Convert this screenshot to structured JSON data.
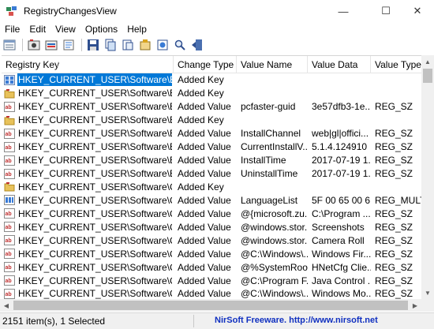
{
  "window": {
    "title": "RegistryChangesView",
    "minimize_glyph": "—",
    "maximize_glyph": "☐",
    "close_glyph": "✕"
  },
  "menu": [
    "File",
    "Edit",
    "View",
    "Options",
    "Help"
  ],
  "toolbar_icons": [
    "columns-icon",
    "save-snapshot-icon",
    "open-snapshot-icon",
    "refresh-icon",
    "save-icon",
    "copy-icon",
    "export-icon",
    "properties-icon",
    "html-report-icon",
    "find-icon",
    "exit-icon"
  ],
  "columns": [
    "Registry Key",
    "Change Type",
    "Value Name",
    "Value Data",
    "Value Type"
  ],
  "sort_indicator": "/",
  "rows": [
    {
      "icon": "reg-key",
      "key": "HKEY_CURRENT_USER\\Software\\Baidu S...",
      "change": "Added Key",
      "name": "",
      "data": "",
      "vtype": "",
      "selected": true
    },
    {
      "icon": "folder",
      "key": "HKEY_CURRENT_USER\\Software\\Baidu S...",
      "change": "Added Key",
      "name": "",
      "data": "",
      "vtype": ""
    },
    {
      "icon": "reg-value",
      "key": "HKEY_CURRENT_USER\\Software\\Baidu S...",
      "change": "Added Value",
      "name": "pcfaster-guid",
      "data": "3e57dfb3-1e...",
      "vtype": "REG_SZ"
    },
    {
      "icon": "folder",
      "key": "HKEY_CURRENT_USER\\Software\\Baidu ...",
      "change": "Added Key",
      "name": "",
      "data": "",
      "vtype": ""
    },
    {
      "icon": "reg-value",
      "key": "HKEY_CURRENT_USER\\Software\\Baidu ...",
      "change": "Added Value",
      "name": "InstallChannel",
      "data": "web|gl|offici...",
      "vtype": "REG_SZ"
    },
    {
      "icon": "reg-value",
      "key": "HKEY_CURRENT_USER\\Software\\Baidu ...",
      "change": "Added Value",
      "name": "CurrentInstallV...",
      "data": "5.1.4.124910",
      "vtype": "REG_SZ"
    },
    {
      "icon": "reg-value",
      "key": "HKEY_CURRENT_USER\\Software\\Baidu ...",
      "change": "Added Value",
      "name": "InstallTime",
      "data": "2017-07-19 1...",
      "vtype": "REG_SZ"
    },
    {
      "icon": "reg-value",
      "key": "HKEY_CURRENT_USER\\Software\\Baidu ...",
      "change": "Added Value",
      "name": "UninstallTime",
      "data": "2017-07-19 1...",
      "vtype": "REG_SZ"
    },
    {
      "icon": "folder",
      "key": "HKEY_CURRENT_USER\\Software\\Classes\\...",
      "change": "Added Key",
      "name": "",
      "data": "",
      "vtype": ""
    },
    {
      "icon": "reg-binary",
      "key": "HKEY_CURRENT_USER\\Software\\Classes\\...",
      "change": "Added Value",
      "name": "LanguageList",
      "data": "5F 00 65 00 6...",
      "vtype": "REG_MULTI_..."
    },
    {
      "icon": "reg-value",
      "key": "HKEY_CURRENT_USER\\Software\\Classes\\...",
      "change": "Added Value",
      "name": "@{microsoft.zu...",
      "data": "C:\\Program ...",
      "vtype": "REG_SZ"
    },
    {
      "icon": "reg-value",
      "key": "HKEY_CURRENT_USER\\Software\\Classes\\...",
      "change": "Added Value",
      "name": "@windows.stor...",
      "data": "Screenshots",
      "vtype": "REG_SZ"
    },
    {
      "icon": "reg-value",
      "key": "HKEY_CURRENT_USER\\Software\\Classes\\...",
      "change": "Added Value",
      "name": "@windows.stor...",
      "data": "Camera Roll",
      "vtype": "REG_SZ"
    },
    {
      "icon": "reg-value",
      "key": "HKEY_CURRENT_USER\\Software\\Classes\\...",
      "change": "Added Value",
      "name": "@C:\\Windows\\...",
      "data": "Windows Fir...",
      "vtype": "REG_SZ"
    },
    {
      "icon": "reg-value",
      "key": "HKEY_CURRENT_USER\\Software\\Classes\\...",
      "change": "Added Value",
      "name": "@%SystemRoo...",
      "data": "HNetCfg Clie...",
      "vtype": "REG_SZ"
    },
    {
      "icon": "reg-value",
      "key": "HKEY_CURRENT_USER\\Software\\Classes\\...",
      "change": "Added Value",
      "name": "@C:\\Program F...",
      "data": "Java Control ...",
      "vtype": "REG_SZ"
    },
    {
      "icon": "reg-value",
      "key": "HKEY_CURRENT_USER\\Software\\Classes\\...",
      "change": "Added Value",
      "name": "@C:\\Windows\\...",
      "data": "Windows Mo...",
      "vtype": "REG_SZ"
    }
  ],
  "status": {
    "count": "2151 item(s), 1 Selected",
    "link": "NirSoft Freeware.  http://www.nirsoft.net"
  },
  "colors": {
    "selection": "#0078d7",
    "link": "#1030c0"
  }
}
